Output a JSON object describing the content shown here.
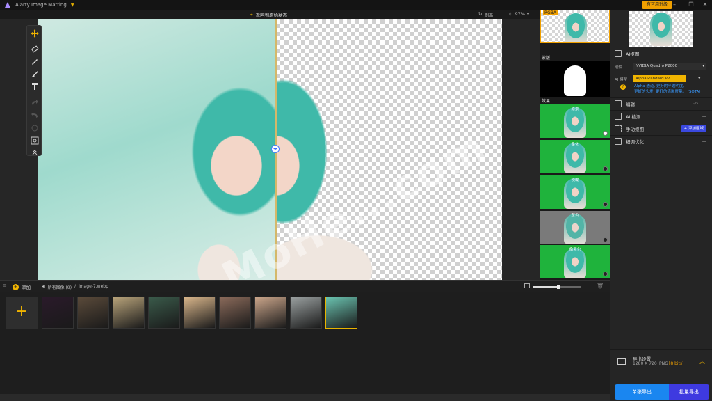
{
  "app": {
    "title": "Aiarty Image Matting",
    "upgrade": "有可用升级"
  },
  "canvas_bar": {
    "revert": "返回到原始状态",
    "refresh": "刷新",
    "zoom": "97%"
  },
  "watermark": "MoHe...com",
  "previews": {
    "rgba_label": "RGBA",
    "mask_label": "蒙版",
    "effects_label": "效果",
    "effects": [
      {
        "caption": "原景",
        "checked": true
      },
      {
        "caption": "柔化",
        "checked": false
      },
      {
        "caption": "模糊",
        "checked": false
      },
      {
        "caption": "灰色",
        "checked": false
      },
      {
        "caption": "像素化",
        "checked": false
      }
    ]
  },
  "sidebar": {
    "ai_matting": "AI抠图",
    "hardware_label": "硬件",
    "hardware_value": "NVIDIA Quadro P2000",
    "model_label": "AI 模型",
    "model_value": "AlphaStandard V2",
    "model_desc1": "Alpha 通道, 更好的半透明度,",
    "model_desc2": "更好的头发, 更好的清晰度量。 (SOTA)",
    "edit": "编辑",
    "ai_detect": "AI 检测",
    "manual_matting": "手动抠图",
    "add_area": "+ 添加区域",
    "refine": "细调优化",
    "export_settings": "导出设置",
    "export_res": "1280 X 720",
    "export_fmt": "PNG",
    "export_bits": "[8 bits]",
    "single_export": "单张导出",
    "batch_export": "批量导出"
  },
  "filebar": {
    "add": "添加",
    "all_images": "所有图像 (9)",
    "separator": "/",
    "current_file": "image-7.webp"
  },
  "files": [
    {
      "color": "#2a1a2a"
    },
    {
      "color": "#5a4a3a"
    },
    {
      "color": "#b8a37a"
    },
    {
      "color": "#3a5a4a"
    },
    {
      "color": "#d8b58a"
    },
    {
      "color": "#8a6a5a"
    },
    {
      "color": "#caa58a"
    },
    {
      "color": "#9aa0a0"
    },
    {
      "color": "#6ac3b0"
    }
  ],
  "colors": {
    "accent": "#f0a000",
    "primary_button": "#1a86f0",
    "batch_button": "#3e3ae0",
    "green_screen": "#1fb33c"
  }
}
